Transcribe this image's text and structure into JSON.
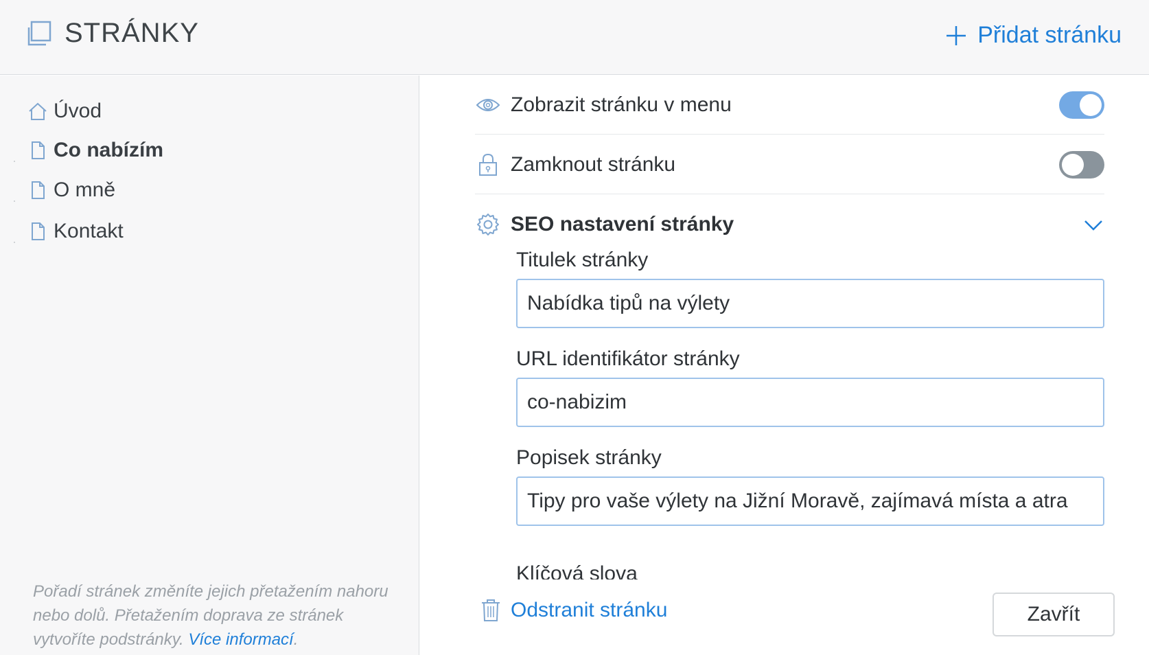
{
  "header": {
    "title": "STRÁNKY",
    "icon": "pages-icon",
    "add_page_label": "Přidat stránku"
  },
  "sidebar": {
    "items": [
      {
        "label": "Úvod",
        "icon": "home-icon",
        "active": false
      },
      {
        "label": "Co nabízím",
        "icon": "page-icon",
        "active": true
      },
      {
        "label": "O mně",
        "icon": "page-icon",
        "active": false
      },
      {
        "label": "Kontakt",
        "icon": "page-icon",
        "active": false
      }
    ],
    "note_text": "Pořadí stránek změníte jejich přetažením nahoru nebo dolů. Přetažením doprava ze stránek vytvoříte podstránky.",
    "note_link": "Více informací",
    "note_end": "."
  },
  "settings": {
    "show_in_menu": {
      "label": "Zobrazit stránku v menu",
      "icon": "eye-icon",
      "enabled": true
    },
    "lock_page": {
      "label": "Zamknout stránku",
      "icon": "lock-icon",
      "enabled": false
    },
    "seo": {
      "label": "SEO nastavení stránky",
      "icon": "gear-icon",
      "expanded": true
    }
  },
  "seo_fields": {
    "title_label": "Titulek stránky",
    "title_value": "Nabídka tipů na výlety",
    "url_label": "URL identifikátor stránky",
    "url_value": "co-nabizim",
    "description_label": "Popisek stránky",
    "description_value": "Tipy pro vaše výlety na Jižní Moravě, zajímavá místa a atra",
    "keywords_label": "Klíčová slova"
  },
  "actions": {
    "delete_label": "Odstranit stránku",
    "close_label": "Zavřít"
  },
  "colors": {
    "accent": "#1f7fd8",
    "toggle_on": "#73a9e4",
    "toggle_off": "#8a949c",
    "input_border": "#9fc3ea",
    "sidebar_bg": "#f7f7f8"
  }
}
